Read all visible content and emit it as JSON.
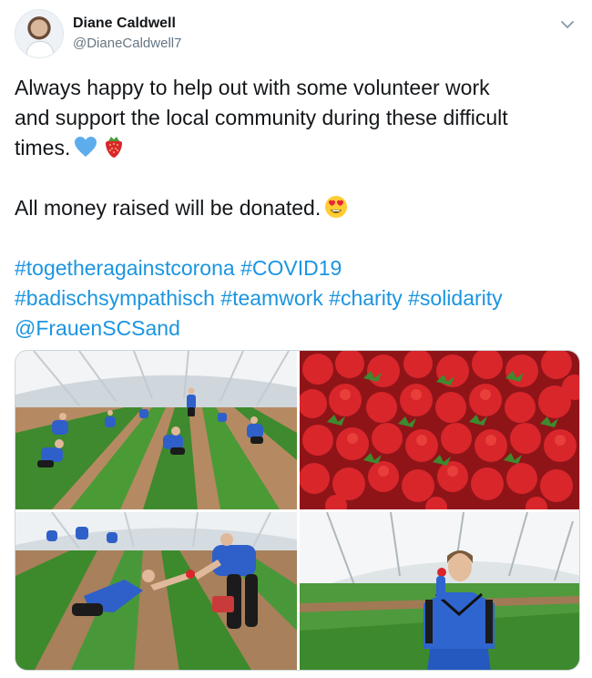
{
  "user": {
    "display_name": "Diane Caldwell",
    "handle": "@DianeCaldwell7"
  },
  "tweet": {
    "line1": "Always happy to help out with some volunteer work",
    "line2": "and support the local community during these difficult",
    "line3": "times.",
    "line4": "All money raised will be donated.",
    "hashtags_line1": [
      "#togetheragainstcorona",
      "#COVID19"
    ],
    "hashtags_line2": [
      "#badischsympathisch",
      "#teamwork",
      "#charity",
      "#solidarity"
    ],
    "mention": "@FrauenSCSand",
    "emojis": [
      "blue-heart",
      "strawberry",
      "heart-eyes"
    ]
  },
  "media": {
    "photos": [
      "strawberry-field-team-picking",
      "strawberries-closeup",
      "players-handing-strawberry",
      "player-holding-strawberry"
    ]
  },
  "colors": {
    "link": "#1b95e0",
    "text": "#14171a",
    "secondary": "#657786"
  }
}
